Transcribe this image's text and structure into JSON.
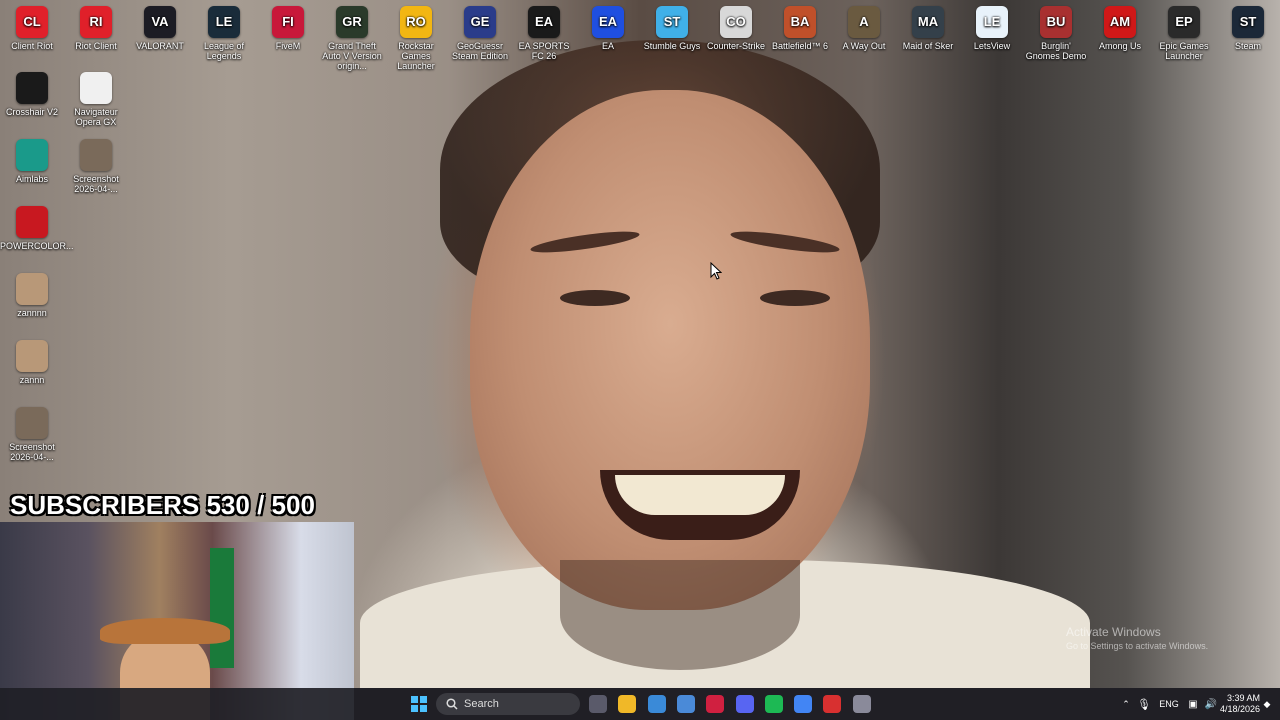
{
  "desktop": {
    "icons_top": [
      {
        "label": "Client Riot",
        "icon": "riot-fist-icon",
        "color": "#e0202a"
      },
      {
        "label": "Riot Client",
        "icon": "riot-fist-icon",
        "color": "#e0202a"
      },
      {
        "label": "VALORANT",
        "icon": "valorant-icon",
        "color": "#1c1c24"
      },
      {
        "label": "League of Legends",
        "icon": "league-icon",
        "color": "#1a2c3a"
      },
      {
        "label": "FiveM",
        "icon": "fivem-icon",
        "color": "#c8183a"
      },
      {
        "label": "Grand Theft Auto V Version origin...",
        "icon": "gta-v-icon",
        "color": "#2a3a2a"
      },
      {
        "label": "Rockstar Games Launcher",
        "icon": "rockstar-icon",
        "color": "#f2b612"
      },
      {
        "label": "GeoGuessr Steam Edition",
        "icon": "geoguessr-icon",
        "color": "#2a3c8a"
      },
      {
        "label": "EA SPORTS FC 26",
        "icon": "fc26-icon",
        "color": "#1a1a1a"
      },
      {
        "label": "EA",
        "icon": "ea-icon",
        "color": "#1f4fe0"
      },
      {
        "label": "Stumble Guys",
        "icon": "stumble-guys-icon",
        "color": "#40b0e8"
      },
      {
        "label": "Counter-Strike",
        "icon": "counter-strike-icon",
        "color": "#d8d8d8"
      },
      {
        "label": "Battlefield™ 6",
        "icon": "battlefield-icon",
        "color": "#c0502a"
      },
      {
        "label": "A Way Out",
        "icon": "a-way-out-icon",
        "color": "#6a5a40"
      },
      {
        "label": "Maid of Sker",
        "icon": "maid-of-sker-icon",
        "color": "#34404a"
      },
      {
        "label": "LetsView",
        "icon": "letsview-icon",
        "color": "#e8f2fa"
      },
      {
        "label": "Burglin' Gnomes Demo",
        "icon": "burglin-gnomes-icon",
        "color": "#a83030"
      },
      {
        "label": "Among Us",
        "icon": "among-us-icon",
        "color": "#d01818"
      },
      {
        "label": "Epic Games Launcher",
        "icon": "epic-games-icon",
        "color": "#2a2a2a"
      },
      {
        "label": "Steam",
        "icon": "steam-icon",
        "color": "#1b2838"
      }
    ],
    "icons_left": [
      {
        "label": "Crosshair V2",
        "icon": "crosshair-icon",
        "color": "#1a1a1a"
      },
      {
        "label": "Navigateur Opera GX",
        "icon": "opera-gx-icon",
        "color": "#f0f0f0"
      },
      {
        "label": "Aimlabs",
        "icon": "aimlabs-icon",
        "color": "#1a9a8a"
      },
      {
        "label": "Screenshot 2026-04-...",
        "icon": "screenshot-thumbnail-icon",
        "color": "#7a6a5a"
      },
      {
        "label": "POWERCOLOR...",
        "icon": "powercolor-icon",
        "color": "#c81820"
      },
      {
        "label": "zannnn",
        "icon": "image-thumbnail-icon",
        "color": "#b89878"
      },
      {
        "label": "zannn",
        "icon": "image-thumbnail-icon",
        "color": "#b89878"
      },
      {
        "label": "Screenshot 2026-04-...",
        "icon": "screenshot-thumbnail-icon",
        "color": "#7a6a5a"
      }
    ],
    "subscribers_text": "SUBSCRIBERS 530 / 500",
    "activate_title": "Activate Windows",
    "activate_sub": "Go to Settings to activate Windows."
  },
  "taskbar": {
    "search_placeholder": "Search",
    "language": "ENG",
    "time": "3:39 AM",
    "date": "4/18/2026",
    "apps": [
      {
        "icon": "task-view-icon",
        "color": "#5a5a6a"
      },
      {
        "icon": "file-explorer-icon",
        "color": "#f0b828"
      },
      {
        "icon": "copilot-icon",
        "color": "#3a8ad8"
      },
      {
        "icon": "microsoft-store-icon",
        "color": "#4a8ad8"
      },
      {
        "icon": "opera-gx-icon",
        "color": "#d02040"
      },
      {
        "icon": "discord-icon",
        "color": "#5865f2"
      },
      {
        "icon": "spotify-icon",
        "color": "#1db954"
      },
      {
        "icon": "chrome-icon",
        "color": "#4285f4"
      },
      {
        "icon": "obs-record-icon",
        "color": "#d83030"
      },
      {
        "icon": "settings-gear-icon",
        "color": "#8a8a9a"
      }
    ]
  }
}
